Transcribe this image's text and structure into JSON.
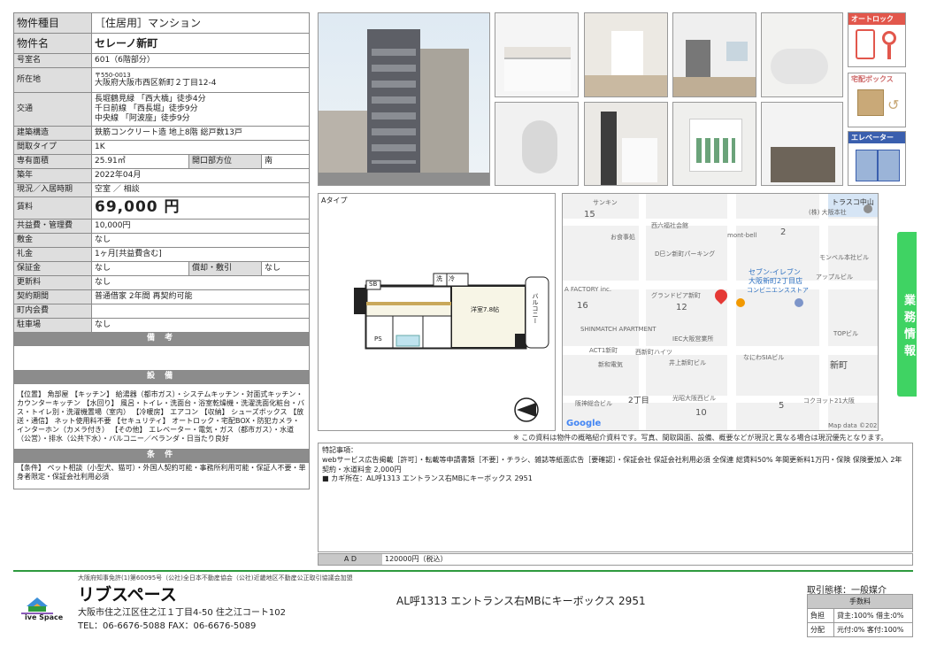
{
  "property": {
    "type_label": "物件種目",
    "type_value": "［住居用］マンション",
    "name_label": "物件名",
    "name_value": "セレーノ新町",
    "room_label": "号室名",
    "room_value": "601（6階部分）",
    "addr_label": "所在地",
    "postal": "〒550-0013",
    "addr_value": "大阪府大阪市西区新町２丁目12-4",
    "transit_label": "交通",
    "transit": [
      "長堀鶴見緑 「西大橋」徒歩4分",
      "千日前線 「西長堀」徒歩9分",
      "中央線 「阿波座」徒歩9分"
    ],
    "struct_label": "建築構造",
    "struct_value": "鉄筋コンクリート造 地上8階 総戸数13戸",
    "layout_label": "間取タイプ",
    "layout_value": "1K",
    "area_label": "専有面積",
    "area_value": "25.91㎡",
    "dir_label": "開口部方位",
    "dir_value": "南",
    "built_label": "築年",
    "built_value": "2022年04月",
    "status_label": "現況／入居時期",
    "status_value": "空室 ／ 相談",
    "rent_label": "賃料",
    "rent_value": "69,000 円",
    "fee_label": "共益費・管理費",
    "fee_value": "10,000円",
    "deposit_label": "敷金",
    "deposit_value": "なし",
    "key_label": "礼金",
    "key_value": "1ヶ月[共益費含む]",
    "guarantee_label": "保証金",
    "guarantee_value": "なし",
    "amort_label": "償却・敷引",
    "amort_value": "なし",
    "renew_label": "更新料",
    "renew_value": "なし",
    "contract_label": "契約期間",
    "contract_value": "普通借家 2年間 再契約可能",
    "town_label": "町内会費",
    "town_value": "",
    "parking_label": "駐車場",
    "parking_value": "なし",
    "remarks_header": "備 考",
    "facilities_header": "設 備",
    "facilities_text": "【位置】 角部屋 【キッチン】 給湯器（都市ガス）・システムキッチン・対面式キッチン・カウンターキッチン 【水回り】 風呂・トイレ・洗面台・浴室乾燥機・洗濯洗面化粧台・バス・トイレ別・洗濯機置場（室内） 【冷暖房】 エアコン 【収納】 シューズボックス 【放送・通信】 ネット使用料不要 【セキュリティ】 オートロック・宅配BOX・防犯カメラ・インターホン（カメラ付き） 【その他】 エレベーター・電気・ガス（都市ガス）・水道（公営）・排水（公共下水）・バルコニー／ベランダ・日当たり良好",
    "conditions_header": "条 件",
    "conditions_text": "【条件】 ペット相談（小型犬、猫可）・外国人契約可能・事務所利用可能・保証人不要・単身者限定・保証会社利用必須"
  },
  "badges": {
    "autolock": "オートロック",
    "delivery_box": "宅配ボックス",
    "elevator": "エレベーター"
  },
  "side_tab": "業務情報",
  "floorplan": {
    "type_label": "Aタイプ",
    "room": "洋室7.8帖",
    "balcony": "バルコニー",
    "sb": "SB",
    "ref": "冷",
    "wash": "洗",
    "ps": "PS"
  },
  "map": {
    "labels": [
      "サンキン",
      "トラスコ中山",
      "(株) 大阪本社",
      "西六福社会館",
      "お食事処",
      "mont-bell",
      "D巳ン新町パーキング",
      "モンベル本社ビル",
      "セブン-イレブン",
      "大阪新町2丁目店",
      "コンビニエンスストア",
      "アップルビル",
      "A FACTORY inc.",
      "グランドビア新町",
      "SHINMATCH APARTMENT",
      "ACT1新町",
      "IEC大阪営業所",
      "西新町ハイツ",
      "井上新町ビル",
      "なにわSIAビル",
      "TOPビル",
      "新町",
      "新和電気",
      "2丁目",
      "阪神総合ビル",
      "光昭大阪西ビル",
      "コクヨット21大阪",
      "Google",
      "Map data ©2022"
    ],
    "numbers": [
      "15",
      "2",
      "16",
      "12",
      "10",
      "5"
    ]
  },
  "disclaimer": "※ この資料は物件の概略紹介資料です。写真、間取図面、設備、概要などが現況と異なる場合は現況優先となります。",
  "special": {
    "title": "特記事項：",
    "line1": "webサービス広告掲載［許可］・転載等申請書類［不要］・チラシ、雑誌等紙面広告［要確認］・保証会社 保証会社利用必須 全保連 総賃料50% 年間更新料1万円・保険 保険要加入 2年契約・水道料金 2,000円",
    "line2": "■ カギ所在：AL呼1313 エントランス右MBにキーボックス 2951"
  },
  "ad": {
    "label": "A D",
    "value": "120000円（税込）"
  },
  "footer": {
    "assoc": "大阪府知事免許(1)第60095号（公社)全日本不動産協会（公社)近畿地区不動産公正取引協議会加盟",
    "company": "リブスペース",
    "logo_text": "ive Space",
    "address": "大阪市住之江区住之江１丁目4-50 住之江コート102",
    "tel": "TEL：06-6676-5088 FAX：06-6676-5089",
    "key_text": "AL呼1313 エントランス右MBにキーボックス 2951",
    "torihiki": "取引態様：一般媒介",
    "fee_header": "手数料",
    "burden_label": "負担",
    "burden_value": "貸主:100% 借主:0%",
    "split_label": "分配",
    "split_value": "元付:0% 客付:100%"
  },
  "colors": {
    "accent_green": "#3fd363",
    "footer_green": "#2e9a3e",
    "badge_red": "#e2574c",
    "header_gray": "#8c8c8c"
  }
}
